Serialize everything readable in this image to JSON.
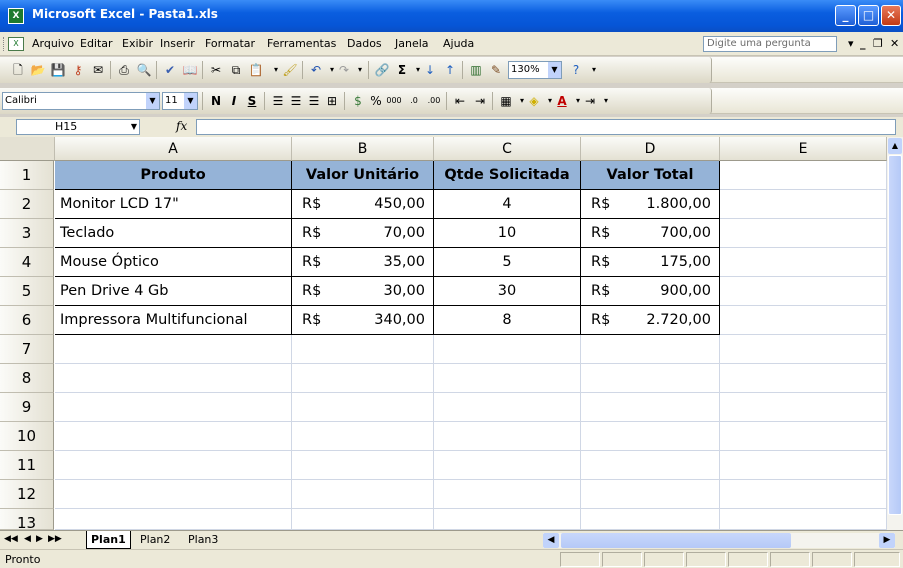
{
  "window": {
    "title": "Microsoft Excel - Pasta1.xls"
  },
  "menu": {
    "items": [
      "Arquivo",
      "Editar",
      "Exibir",
      "Inserir",
      "Formatar",
      "Ferramentas",
      "Dados",
      "Janela",
      "Ajuda"
    ],
    "help_placeholder": "Digite uma pergunta"
  },
  "toolbar": {
    "zoom": "130%",
    "font": "Calibri",
    "font_size": "11"
  },
  "formula_bar": {
    "name_box": "H15",
    "fx": "fx",
    "content": ""
  },
  "columns": [
    "A",
    "B",
    "C",
    "D",
    "E"
  ],
  "rows": [
    "1",
    "2",
    "3",
    "4",
    "5",
    "6",
    "7",
    "8",
    "9",
    "10",
    "11",
    "12",
    "13"
  ],
  "table": {
    "headers": [
      "Produto",
      "Valor Unitário",
      "Qtde Solicitada",
      "Valor Total"
    ],
    "currency": "R$",
    "data": [
      {
        "produto": "Monitor LCD 17\"",
        "unit": "450,00",
        "qtd": "4",
        "total": "1.800,00"
      },
      {
        "produto": "Teclado",
        "unit": "70,00",
        "qtd": "10",
        "total": "700,00"
      },
      {
        "produto": "Mouse Óptico",
        "unit": "35,00",
        "qtd": "5",
        "total": "175,00"
      },
      {
        "produto": "Pen Drive 4 Gb",
        "unit": "30,00",
        "qtd": "30",
        "total": "900,00"
      },
      {
        "produto": "Impressora Multifuncional",
        "unit": "340,00",
        "qtd": "8",
        "total": "2.720,00"
      }
    ]
  },
  "sheets": [
    "Plan1",
    "Plan2",
    "Plan3"
  ],
  "status": {
    "text": "Pronto"
  },
  "colors": {
    "header_fill": "#95b3d7",
    "titlebar": "#0a5ee0"
  }
}
